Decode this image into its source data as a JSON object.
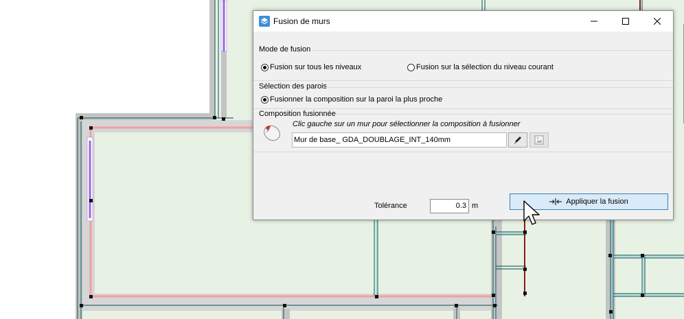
{
  "dialog": {
    "title": "Fusion de murs",
    "icons": {
      "app": "layers-icon",
      "minimize": "minimize-icon",
      "maximize": "maximize-icon",
      "close": "close-icon"
    },
    "mode": {
      "label": "Mode de fusion",
      "options": [
        {
          "label": "Fusion sur tous les niveaux",
          "checked": true
        },
        {
          "label": "Fusion sur la sélection du niveau courant",
          "checked": false
        }
      ]
    },
    "walls": {
      "label": "Sélection des parois",
      "options": [
        {
          "label": "Fusionner la composition sur la paroi la plus proche",
          "checked": true
        }
      ]
    },
    "composition": {
      "label": "Composition fusionnée",
      "hint": "Clic gauche sur un mur pour sélectionner la composition à fusionner",
      "value": "Mur de base_ GDA_DOUBLAGE_INT_140mm",
      "icons": {
        "mouse": "mouse-icon",
        "edit": "pencil-icon",
        "pick": "picture-icon"
      }
    },
    "tolerance": {
      "label": "Tolérance",
      "value": "0.3",
      "unit": "m"
    },
    "apply": {
      "label": "Appliquer la fusion",
      "icon": "merge-icon"
    }
  },
  "colors": {
    "canvas_fill": "#e8f2e4",
    "wall_gray": "#c4c4c4",
    "wall_line": "#2a6e6e",
    "selection_red": "#f2a0a0",
    "purple": "#9966dd",
    "dark_red": "#8b1a1a",
    "accent": "#3c7fb1"
  }
}
